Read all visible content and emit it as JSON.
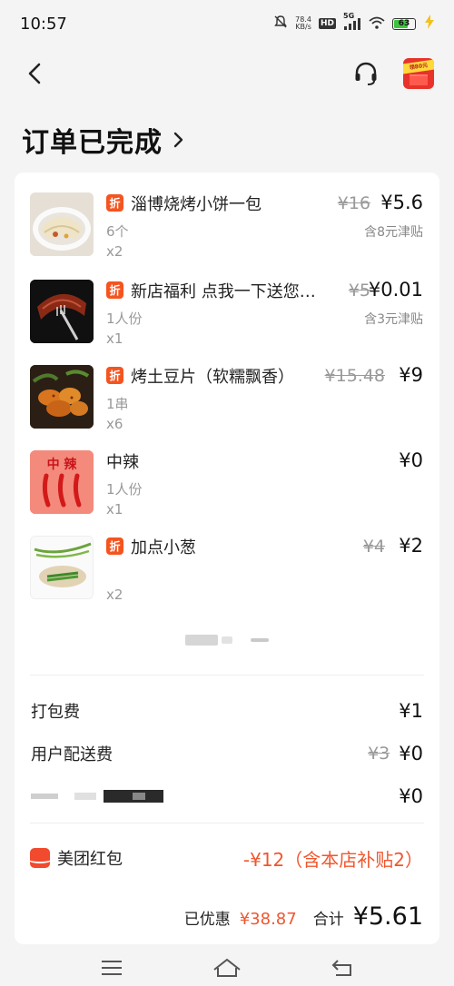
{
  "status_bar": {
    "time": "10:57",
    "net_speed_value": "78.4",
    "net_speed_unit": "KB/s",
    "hd_badge": "HD",
    "signal_label": "5G",
    "battery": "63"
  },
  "header": {
    "title": "订单已完成",
    "promo_ribbon": "领80元"
  },
  "items": [
    {
      "name": "淄博烧烤小饼一包",
      "has_discount_tag": true,
      "discount_tag": "折",
      "spec": "6个",
      "qty": "x2",
      "original_price": "¥16",
      "price": "¥5.6",
      "subsidy": "含8元津贴"
    },
    {
      "name": "新店福利 点我一下送您…",
      "has_discount_tag": true,
      "discount_tag": "折",
      "spec": "1人份",
      "qty": "x1",
      "original_price": "¥5",
      "price": "¥0.01",
      "subsidy": "含3元津贴"
    },
    {
      "name": "烤土豆片（软糯飘香）",
      "has_discount_tag": true,
      "discount_tag": "折",
      "spec": "1串",
      "qty": "x6",
      "original_price": "¥15.48",
      "price": "¥9",
      "subsidy": ""
    },
    {
      "name": "中辣",
      "has_discount_tag": false,
      "discount_tag": "",
      "spec": "1人份",
      "qty": "x1",
      "original_price": "",
      "price": "¥0",
      "subsidy": ""
    },
    {
      "name": "加点小葱",
      "has_discount_tag": true,
      "discount_tag": "折",
      "spec": "",
      "qty": "x2",
      "original_price": "¥4",
      "price": "¥2",
      "subsidy": ""
    }
  ],
  "thumb_text": {
    "chili_label": "中 辣"
  },
  "fees": {
    "packing_label": "打包费",
    "packing_value": "¥1",
    "delivery_label": "用户配送费",
    "delivery_original": "¥3",
    "delivery_value": "¥0",
    "hidden_row_value": "¥0"
  },
  "redpack": {
    "label": "美团红包",
    "value": "-¥12（含本店补贴2）"
  },
  "totals": {
    "saved_label": "已优惠",
    "saved_value": "¥38.87",
    "total_label": "合计",
    "total_value": "¥5.61"
  },
  "colors": {
    "accent": "#f0562e",
    "discount_tag": "#f5541f",
    "battery_green": "#3fc43f"
  }
}
